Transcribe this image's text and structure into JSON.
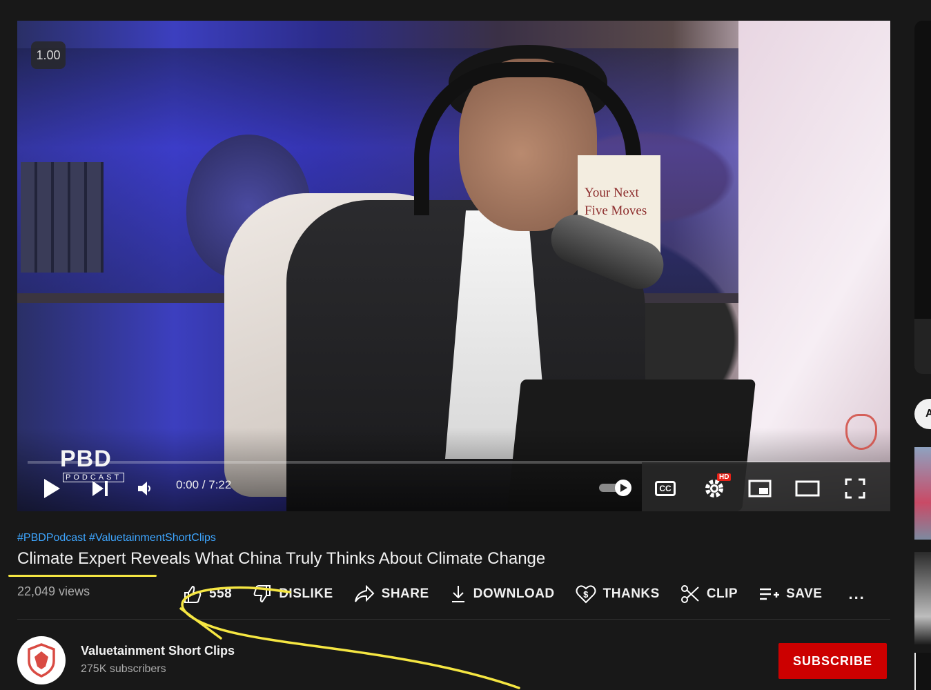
{
  "player": {
    "speed_badge": "1.00",
    "time": "0:00 / 7:22",
    "cc_label": "CC",
    "hd_badge": "HD",
    "watermark_logo": "PBD",
    "watermark_sub": "PODCAST",
    "book_title": "Your Next Five Moves",
    "progress_fraction": 0.0
  },
  "video": {
    "hashtags": "#PBDPodcast #ValuetainmentShortClips",
    "title": "Climate Expert Reveals What China Truly Thinks About Climate Change",
    "views": "22,049 views"
  },
  "actions": {
    "like_count": "558",
    "dislike": "DISLIKE",
    "share": "SHARE",
    "download": "DOWNLOAD",
    "thanks": "THANKS",
    "clip": "CLIP",
    "save": "SAVE",
    "more": "..."
  },
  "channel": {
    "name": "Valuetainment Short Clips",
    "subscribers": "275K subscribers",
    "subscribe_label": "SUBSCRIBE"
  },
  "sidebar": {
    "chip_letter": "A"
  },
  "colors": {
    "link": "#3ea6ff",
    "subscribe": "#cc0000",
    "annotation": "#f5e642"
  }
}
